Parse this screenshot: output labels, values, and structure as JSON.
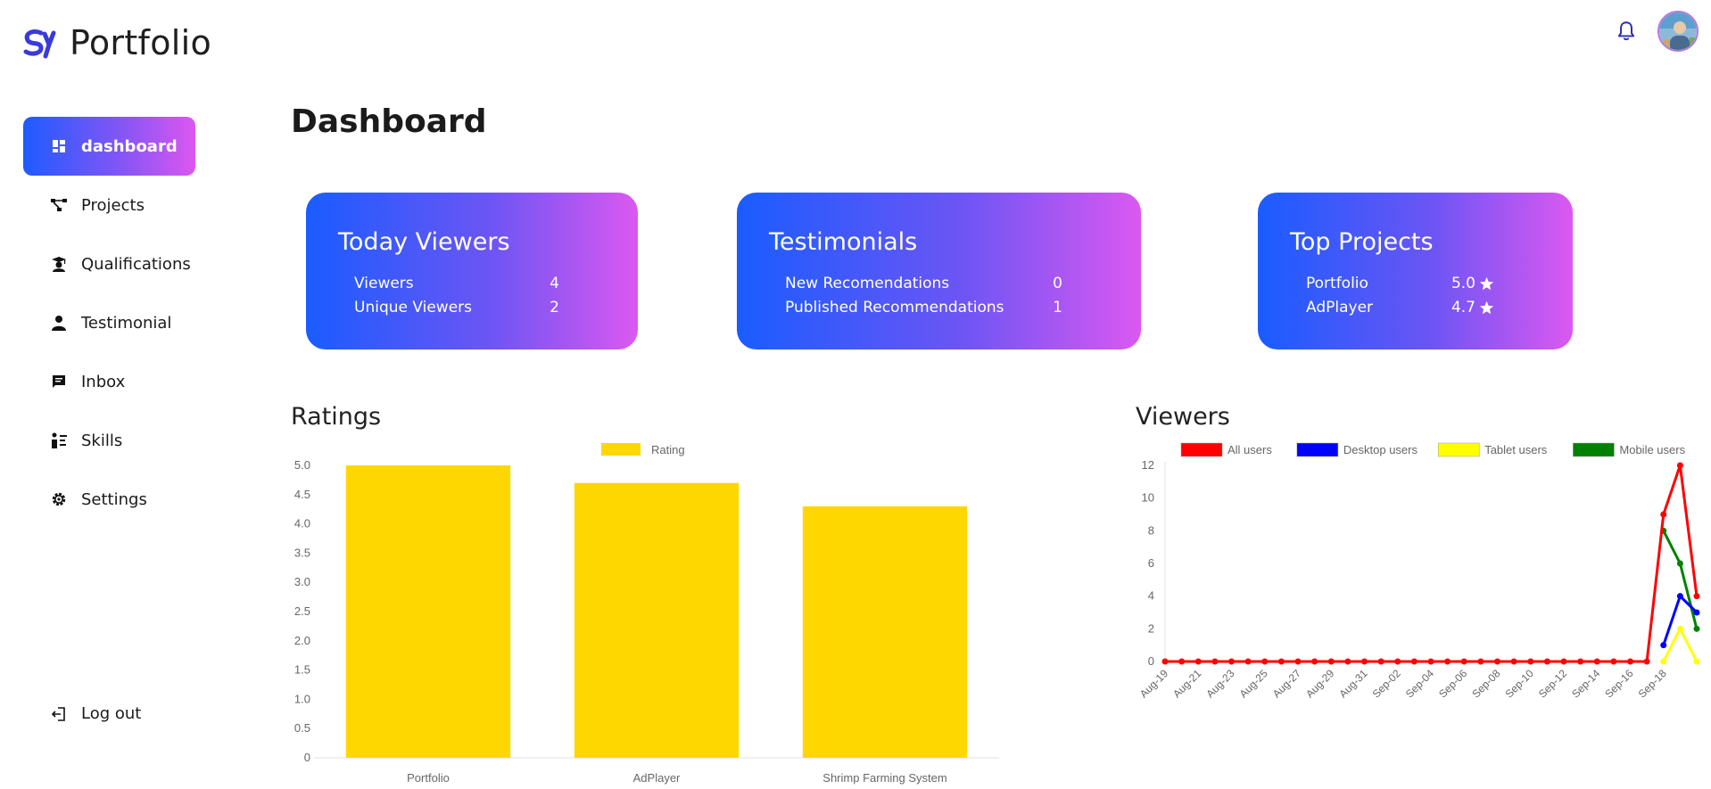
{
  "brand": {
    "name": "Portfolio"
  },
  "sidebar": {
    "items": [
      {
        "label": "dashboard",
        "icon": "dashboard-icon",
        "active": true
      },
      {
        "label": "Projects",
        "icon": "projects-icon"
      },
      {
        "label": "Qualifications",
        "icon": "graduation-icon"
      },
      {
        "label": "Testimonial",
        "icon": "user-icon"
      },
      {
        "label": "Inbox",
        "icon": "message-icon"
      },
      {
        "label": "Skills",
        "icon": "skills-icon"
      },
      {
        "label": "Settings",
        "icon": "gear-icon"
      }
    ],
    "logout": "Log out"
  },
  "page": {
    "title": "Dashboard"
  },
  "cards": {
    "viewers": {
      "title": "Today Viewers",
      "rows": [
        {
          "label": "Viewers",
          "value": "4"
        },
        {
          "label": "Unique Viewers",
          "value": "2"
        }
      ]
    },
    "testimonials": {
      "title": "Testimonials",
      "rows": [
        {
          "label": "New Recomendations",
          "value": "0"
        },
        {
          "label": "Published Recommendations",
          "value": "1"
        }
      ]
    },
    "top_projects": {
      "title": "Top Projects",
      "rows": [
        {
          "label": "Portfolio",
          "value": "5.0"
        },
        {
          "label": "AdPlayer",
          "value": "4.7"
        }
      ]
    }
  },
  "sections": {
    "ratings": "Ratings",
    "viewers": "Viewers"
  },
  "colors": {
    "accent_start": "#1a5cff",
    "accent_end": "#db58f1",
    "bar": "#ffd700"
  },
  "chart_data": [
    {
      "type": "bar",
      "categories": [
        "Portfolio",
        "AdPlayer",
        "Shrimp Farming System"
      ],
      "series": [
        {
          "name": "Rating",
          "values": [
            5.0,
            4.7,
            4.3
          ],
          "color": "#ffd700"
        }
      ],
      "ylim": [
        0,
        5
      ],
      "yticks": [
        "0",
        "0.5",
        "1.0",
        "1.5",
        "2.0",
        "2.5",
        "3.0",
        "3.5",
        "4.0",
        "4.5",
        "5.0"
      ],
      "legend": "top"
    },
    {
      "type": "line",
      "x": [
        "Aug-19",
        "Aug-20",
        "Aug-21",
        "Aug-22",
        "Aug-23",
        "Aug-24",
        "Aug-25",
        "Aug-26",
        "Aug-27",
        "Aug-28",
        "Aug-29",
        "Aug-30",
        "Aug-31",
        "Sep-01",
        "Sep-02",
        "Sep-03",
        "Sep-04",
        "Sep-05",
        "Sep-06",
        "Sep-07",
        "Sep-08",
        "Sep-09",
        "Sep-10",
        "Sep-11",
        "Sep-12",
        "Sep-13",
        "Sep-14",
        "Sep-15",
        "Sep-16",
        "Sep-17",
        "Sep-18",
        "Sep-19",
        "Sep-20"
      ],
      "xticks": [
        "Aug-19",
        "Aug-21",
        "Aug-23",
        "Aug-25",
        "Aug-27",
        "Aug-29",
        "Aug-31",
        "Sep-02",
        "Sep-04",
        "Sep-06",
        "Sep-08",
        "Sep-10",
        "Sep-12",
        "Sep-14",
        "Sep-16",
        "Sep-18"
      ],
      "series": [
        {
          "name": "All users",
          "color": "#ff0000",
          "values": [
            0,
            0,
            0,
            0,
            0,
            0,
            0,
            0,
            0,
            0,
            0,
            0,
            0,
            0,
            0,
            0,
            0,
            0,
            0,
            0,
            0,
            0,
            0,
            0,
            0,
            0,
            0,
            0,
            0,
            0,
            9,
            12,
            4
          ]
        },
        {
          "name": "Desktop users",
          "color": "#0000ff",
          "values": [
            null,
            null,
            null,
            null,
            null,
            null,
            null,
            null,
            null,
            null,
            null,
            null,
            null,
            null,
            null,
            null,
            null,
            null,
            null,
            null,
            null,
            null,
            null,
            null,
            null,
            null,
            null,
            null,
            null,
            null,
            1,
            4,
            3
          ]
        },
        {
          "name": "Tablet users",
          "color": "#ffff00",
          "values": [
            null,
            null,
            null,
            null,
            null,
            null,
            null,
            null,
            null,
            null,
            null,
            null,
            null,
            null,
            null,
            null,
            null,
            null,
            null,
            null,
            null,
            null,
            null,
            null,
            null,
            null,
            null,
            null,
            null,
            null,
            0,
            2,
            0
          ]
        },
        {
          "name": "Mobile users",
          "color": "#008000",
          "values": [
            null,
            null,
            null,
            null,
            null,
            null,
            null,
            null,
            null,
            null,
            null,
            null,
            null,
            null,
            null,
            null,
            null,
            null,
            null,
            null,
            null,
            null,
            null,
            null,
            null,
            null,
            null,
            null,
            null,
            null,
            8,
            6,
            2
          ]
        }
      ],
      "ylim": [
        0,
        12
      ],
      "yticks": [
        "0",
        "2",
        "4",
        "6",
        "8",
        "10",
        "12"
      ],
      "legend": "top"
    }
  ]
}
